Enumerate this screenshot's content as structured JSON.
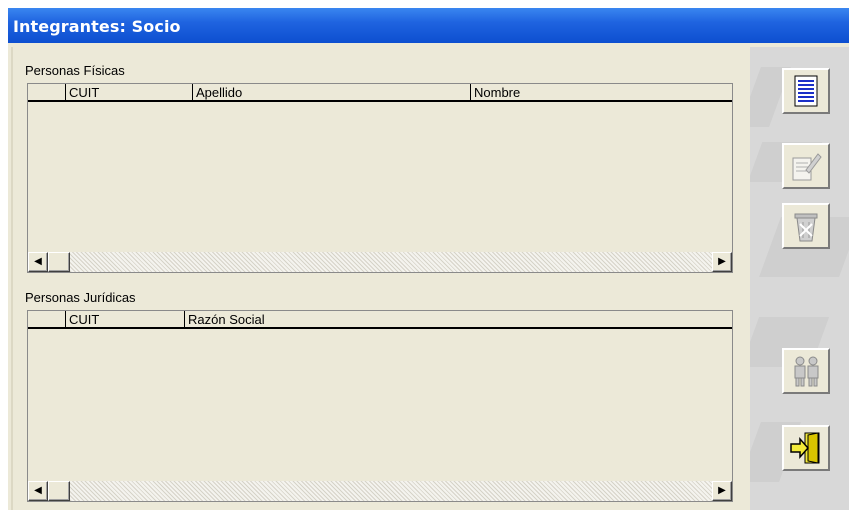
{
  "window": {
    "title": "Integrantes: Socio"
  },
  "personas_fisicas": {
    "label": "Personas Físicas",
    "columns": [
      "",
      "CUIT",
      "Apellido",
      "Nombre"
    ],
    "rows": []
  },
  "personas_juridicas": {
    "label": "Personas Jurídicas",
    "columns": [
      "",
      "CUIT",
      "Razón Social"
    ],
    "rows": []
  },
  "toolbar": {
    "buttons": [
      {
        "name": "new-document",
        "icon": "document-list-icon",
        "enabled": true
      },
      {
        "name": "edit",
        "icon": "edit-pen-icon",
        "enabled": false
      },
      {
        "name": "delete",
        "icon": "trash-icon",
        "enabled": false
      },
      {
        "name": "members",
        "icon": "people-icon",
        "enabled": false
      },
      {
        "name": "exit",
        "icon": "exit-door-icon",
        "enabled": true
      }
    ]
  },
  "colors": {
    "title_bar": "#0d4fd0",
    "window_bg": "#ece9d8",
    "toolbar_bg": "#d8d8d8"
  }
}
